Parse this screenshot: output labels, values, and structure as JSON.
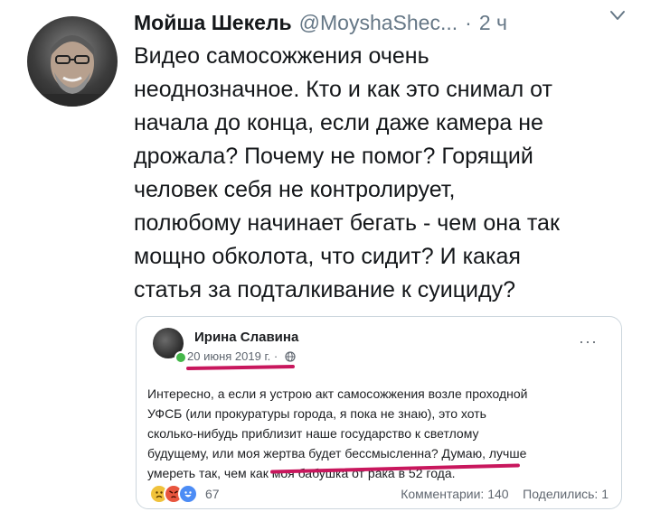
{
  "tweet": {
    "display_name": "Мойша Шекель",
    "handle": "@MoyshaShec...",
    "separator": "·",
    "time": "2 ч",
    "avatar_icon": "user-photo-avatar",
    "menu_icon": "chevron-down-icon",
    "text_lines": [
      "Видео самосожжения очень",
      "неоднозначное. Кто и как это снимал от",
      "начала до конца, если даже камера не",
      "дрожала? Почему не помог? Горящий",
      "человек себя не контролирует,",
      "полюбому начинает бегать - чем она так",
      "мощно обколота, что сидит? И какая",
      "статья за подталкивание к суициду?"
    ]
  },
  "embedded_post": {
    "author": "Ирина Славина",
    "date": "20 июня 2019 г.",
    "date_suffix": "·",
    "privacy_icon": "globe-icon",
    "more_icon": "more-dots-icon",
    "more_glyph": "···",
    "text_lines": [
      "Интересно, а если я устрою акт самосожжения возле проходной",
      "УФСБ (или прокуратуры города, я пока не знаю), это хоть",
      "сколько-нибудь приблизит наше государство к светлому",
      "будущему, или моя жертва будет бессмысленна? Думаю, лучше",
      "умереть так, чем как моя бабушка от рака в 52 года."
    ],
    "reactions": [
      "sad",
      "angry",
      "haha"
    ],
    "reaction_count": "67",
    "comments": "Комментарии: 140",
    "shares": "Поделились: 1",
    "highlight_color": "#c8175d"
  },
  "colors": {
    "text": "#14171a",
    "secondary": "#657786",
    "card_border": "#ccd6dd",
    "fb_text": "#1c1e21",
    "fb_secondary": "#606770"
  }
}
